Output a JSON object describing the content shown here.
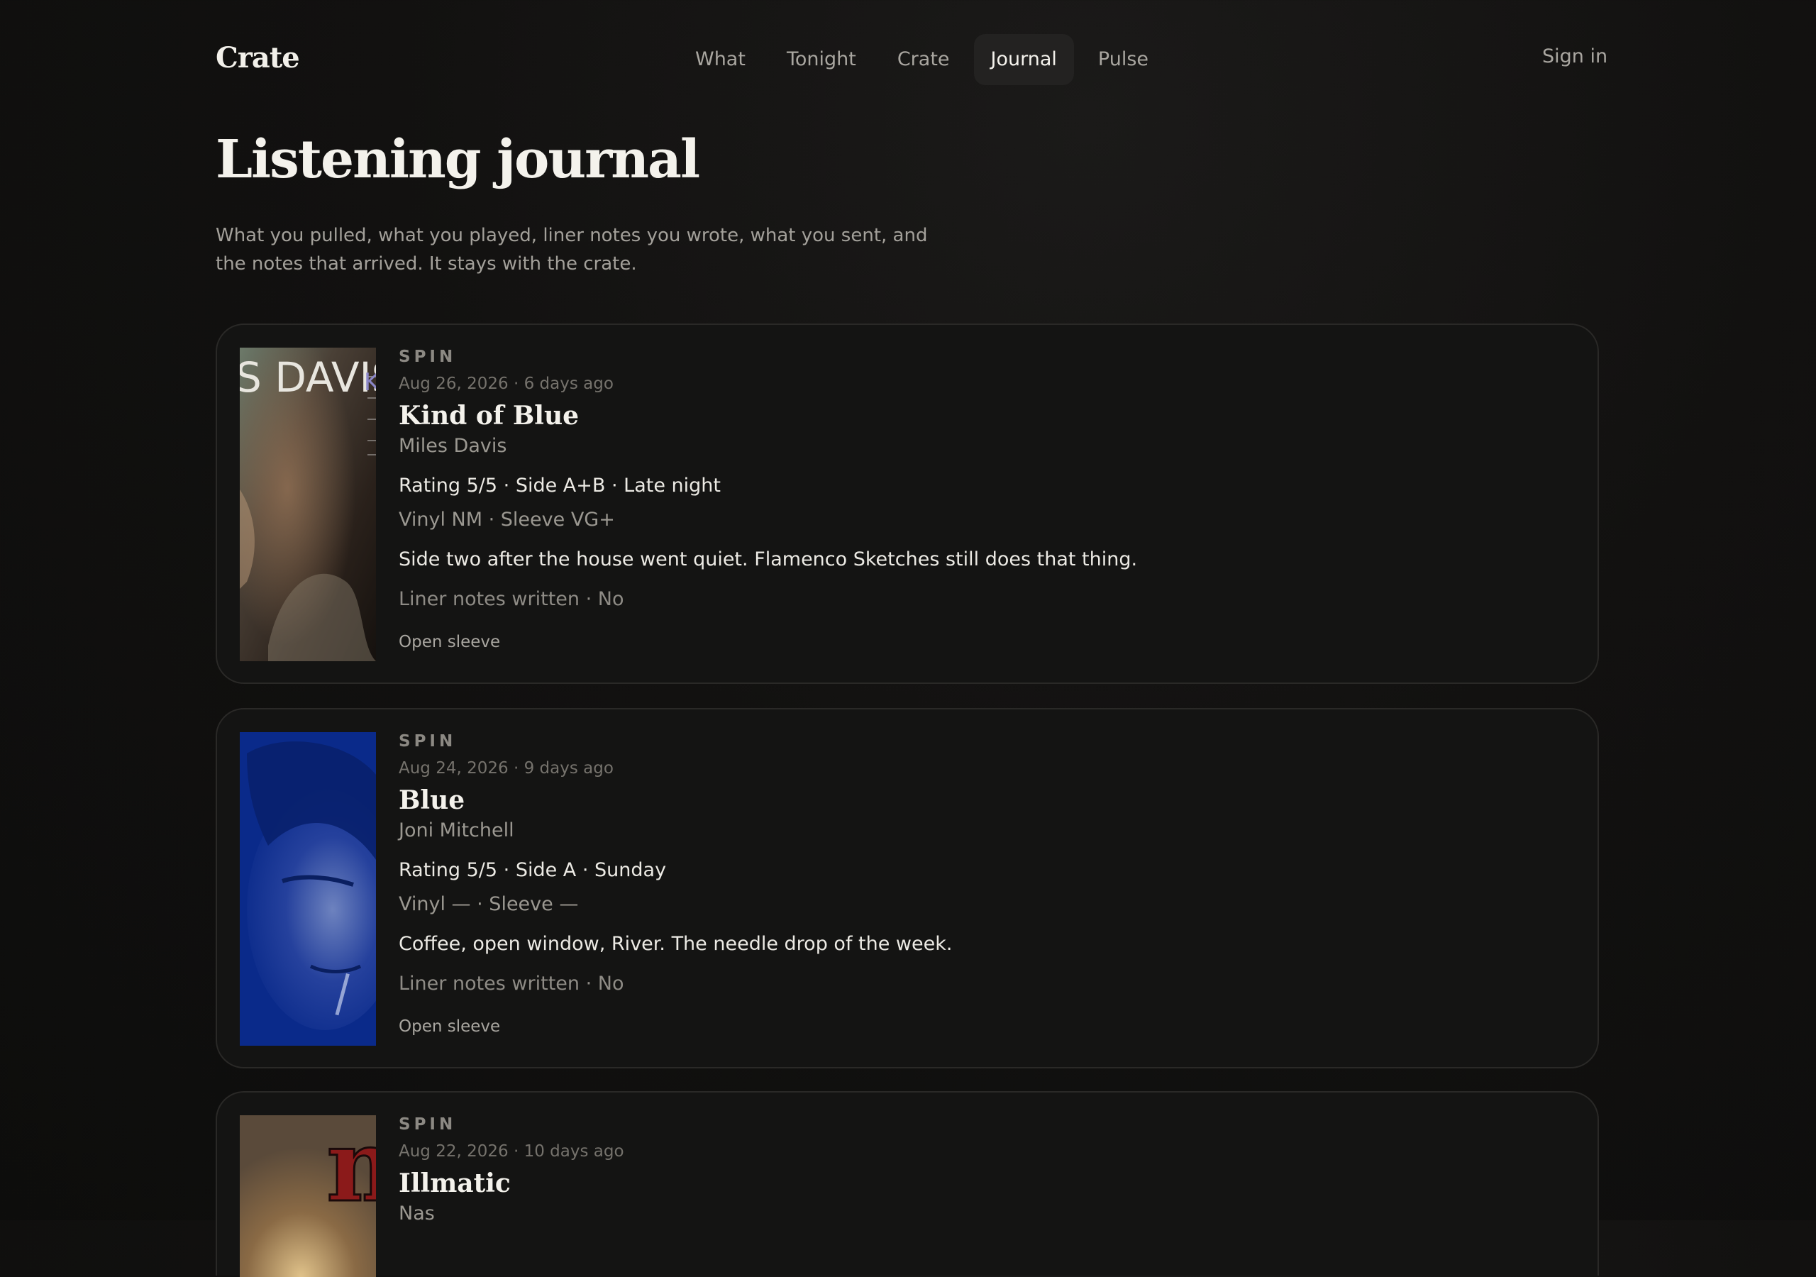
{
  "header": {
    "logo": "Crate",
    "nav": [
      "What",
      "Tonight",
      "Crate",
      "Journal",
      "Pulse"
    ],
    "active_nav": "Journal",
    "sign_in": "Sign in"
  },
  "page": {
    "title": "Listening journal",
    "intro": "What you pulled, what you played, liner notes you wrote, what you sent, and the notes that arrived. It stays with the crate."
  },
  "entries": [
    {
      "kind": "SPIN",
      "date": "Aug 26, 2026 · 6 days ago",
      "title": "Kind of Blue",
      "artist": "Miles Davis",
      "meta": "Rating 5/5 · Side A+B · Late night",
      "condition": "Vinyl NM · Sleeve VG+",
      "note": "Side two after the house went quiet. Flamenco Sketches still does that thing.",
      "liner": "Liner notes written · No",
      "action": "Open sleeve",
      "cover_text": "S DAVIS",
      "cover_text2": "K"
    },
    {
      "kind": "SPIN",
      "date": "Aug 24, 2026 · 9 days ago",
      "title": "Blue",
      "artist": "Joni Mitchell",
      "meta": "Rating 5/5 · Side A · Sunday",
      "condition": "Vinyl — · Sleeve —",
      "note": "Coffee, open window, River. The needle drop of the week.",
      "liner": "Liner notes written · No",
      "action": "Open sleeve"
    },
    {
      "kind": "SPIN",
      "date": "Aug 22, 2026 · 10 days ago",
      "title": "Illmatic",
      "artist": "Nas",
      "cover_text": "m"
    }
  ],
  "colors": {
    "background": "#121110",
    "card": "#141413",
    "card_border": "#2a2927",
    "active_nav_bg": "#232221",
    "blue_cover": "#0a2a8a"
  }
}
